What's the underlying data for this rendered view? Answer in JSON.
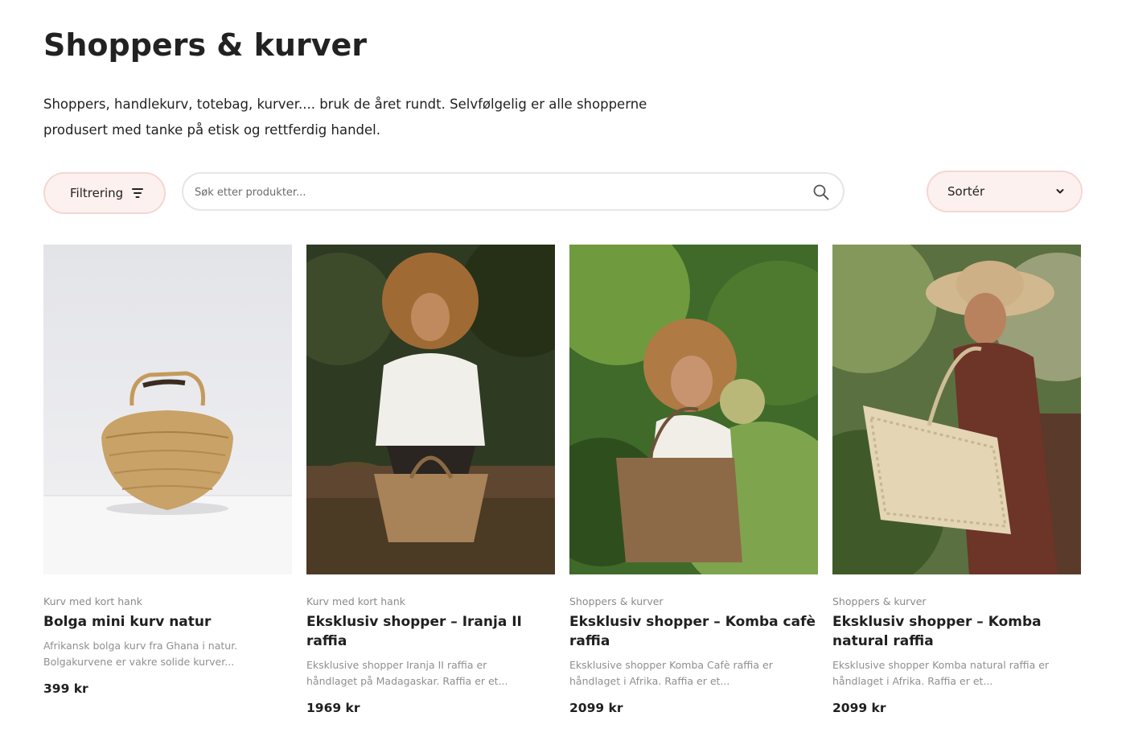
{
  "page": {
    "title": "Shoppers & kurver",
    "intro": "Shoppers, handlekurv, totebag, kurver.... bruk de året rundt. Selvfølgelig er alle shopperne produsert med tanke på etisk og rettferdig handel."
  },
  "toolbar": {
    "filter_label": "Filtrering",
    "filter_icon": "filter-lines-icon",
    "search_placeholder": "Søk etter produkter...",
    "search_value": "",
    "search_icon": "search-icon",
    "sort_label": "Sortér",
    "sort_icon": "chevron-down-icon"
  },
  "colors": {
    "pill_bg": "#fdf1ef",
    "pill_border": "#f6d6d0",
    "muted_text": "#8a8a8a"
  },
  "products": [
    {
      "category": "Kurv med kort hank",
      "title": "Bolga mini kurv natur",
      "description": "Afrikansk bolga kurv fra Ghana i natur. Bolgakurvene er vakre solide kurver...",
      "price": "399 kr"
    },
    {
      "category": "Kurv med kort hank",
      "title": "Eksklusiv shopper – Iranja II raffia",
      "description": "Eksklusive  shopper Iranja II raffia er håndlaget på Madagaskar. Raffia er et...",
      "price": "1969 kr"
    },
    {
      "category": "Shoppers & kurver",
      "title": "Eksklusiv shopper – Komba cafè raffia",
      "description": "Eksklusive  shopper Komba Cafè raffia er håndlaget i Afrika. Raffia er et...",
      "price": "2099 kr"
    },
    {
      "category": "Shoppers & kurver",
      "title": "Eksklusiv shopper – Komba natural raffia",
      "description": "Eksklusive  shopper Komba natural raffia er håndlaget i Afrika. Raffia er et...",
      "price": "2099 kr"
    }
  ]
}
